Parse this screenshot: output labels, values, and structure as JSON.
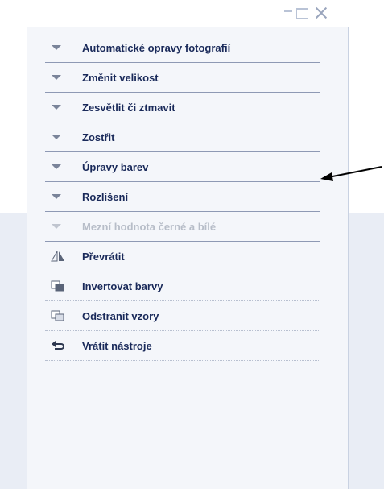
{
  "panel": {
    "expanders": [
      {
        "label": "Automatické opravy fotografií",
        "enabled": true
      },
      {
        "label": "Změnit velikost",
        "enabled": true
      },
      {
        "label": "Zesvětlit či ztmavit",
        "enabled": true
      },
      {
        "label": "Zostřit",
        "enabled": true
      },
      {
        "label": "Úpravy barev",
        "enabled": true
      },
      {
        "label": "Rozlišení",
        "enabled": true
      },
      {
        "label": "Mezní hodnota černé a bílé",
        "enabled": false
      }
    ],
    "tools": [
      {
        "label": "Převrátit",
        "icon": "flip-icon"
      },
      {
        "label": "Invertovat barvy",
        "icon": "invert-colors-icon"
      },
      {
        "label": "Odstranit vzory",
        "icon": "remove-patterns-icon"
      },
      {
        "label": "Vrátit nástroje",
        "icon": "undo-arrow-icon"
      }
    ]
  },
  "window_controls": [
    "minimize-icon",
    "maximize-icon",
    "close-icon"
  ],
  "colors": {
    "label": "#1a2a5a",
    "disabled_label": "#b7bdc8",
    "panel_bg": "#f4f6fa",
    "outer_bg": "#e9edf5"
  }
}
